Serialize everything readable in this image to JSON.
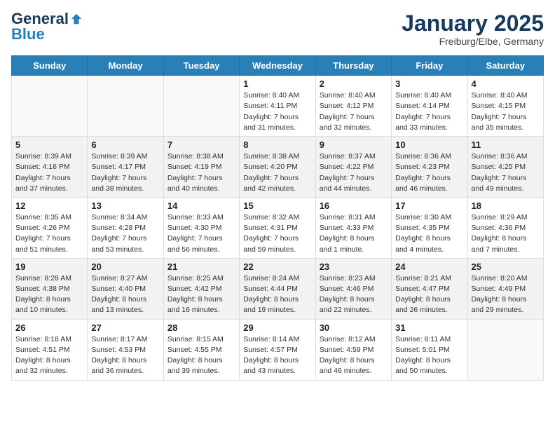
{
  "header": {
    "logo_general": "General",
    "logo_blue": "Blue",
    "month_title": "January 2025",
    "location": "Freiburg/Elbe, Germany"
  },
  "weekdays": [
    "Sunday",
    "Monday",
    "Tuesday",
    "Wednesday",
    "Thursday",
    "Friday",
    "Saturday"
  ],
  "weeks": [
    {
      "shaded": false,
      "days": [
        {
          "num": "",
          "info": ""
        },
        {
          "num": "",
          "info": ""
        },
        {
          "num": "",
          "info": ""
        },
        {
          "num": "1",
          "info": "Sunrise: 8:40 AM\nSunset: 4:11 PM\nDaylight: 7 hours\nand 31 minutes."
        },
        {
          "num": "2",
          "info": "Sunrise: 8:40 AM\nSunset: 4:12 PM\nDaylight: 7 hours\nand 32 minutes."
        },
        {
          "num": "3",
          "info": "Sunrise: 8:40 AM\nSunset: 4:14 PM\nDaylight: 7 hours\nand 33 minutes."
        },
        {
          "num": "4",
          "info": "Sunrise: 8:40 AM\nSunset: 4:15 PM\nDaylight: 7 hours\nand 35 minutes."
        }
      ]
    },
    {
      "shaded": true,
      "days": [
        {
          "num": "5",
          "info": "Sunrise: 8:39 AM\nSunset: 4:16 PM\nDaylight: 7 hours\nand 37 minutes."
        },
        {
          "num": "6",
          "info": "Sunrise: 8:39 AM\nSunset: 4:17 PM\nDaylight: 7 hours\nand 38 minutes."
        },
        {
          "num": "7",
          "info": "Sunrise: 8:38 AM\nSunset: 4:19 PM\nDaylight: 7 hours\nand 40 minutes."
        },
        {
          "num": "8",
          "info": "Sunrise: 8:38 AM\nSunset: 4:20 PM\nDaylight: 7 hours\nand 42 minutes."
        },
        {
          "num": "9",
          "info": "Sunrise: 8:37 AM\nSunset: 4:22 PM\nDaylight: 7 hours\nand 44 minutes."
        },
        {
          "num": "10",
          "info": "Sunrise: 8:36 AM\nSunset: 4:23 PM\nDaylight: 7 hours\nand 46 minutes."
        },
        {
          "num": "11",
          "info": "Sunrise: 8:36 AM\nSunset: 4:25 PM\nDaylight: 7 hours\nand 49 minutes."
        }
      ]
    },
    {
      "shaded": false,
      "days": [
        {
          "num": "12",
          "info": "Sunrise: 8:35 AM\nSunset: 4:26 PM\nDaylight: 7 hours\nand 51 minutes."
        },
        {
          "num": "13",
          "info": "Sunrise: 8:34 AM\nSunset: 4:28 PM\nDaylight: 7 hours\nand 53 minutes."
        },
        {
          "num": "14",
          "info": "Sunrise: 8:33 AM\nSunset: 4:30 PM\nDaylight: 7 hours\nand 56 minutes."
        },
        {
          "num": "15",
          "info": "Sunrise: 8:32 AM\nSunset: 4:31 PM\nDaylight: 7 hours\nand 59 minutes."
        },
        {
          "num": "16",
          "info": "Sunrise: 8:31 AM\nSunset: 4:33 PM\nDaylight: 8 hours\nand 1 minute."
        },
        {
          "num": "17",
          "info": "Sunrise: 8:30 AM\nSunset: 4:35 PM\nDaylight: 8 hours\nand 4 minutes."
        },
        {
          "num": "18",
          "info": "Sunrise: 8:29 AM\nSunset: 4:36 PM\nDaylight: 8 hours\nand 7 minutes."
        }
      ]
    },
    {
      "shaded": true,
      "days": [
        {
          "num": "19",
          "info": "Sunrise: 8:28 AM\nSunset: 4:38 PM\nDaylight: 8 hours\nand 10 minutes."
        },
        {
          "num": "20",
          "info": "Sunrise: 8:27 AM\nSunset: 4:40 PM\nDaylight: 8 hours\nand 13 minutes."
        },
        {
          "num": "21",
          "info": "Sunrise: 8:25 AM\nSunset: 4:42 PM\nDaylight: 8 hours\nand 16 minutes."
        },
        {
          "num": "22",
          "info": "Sunrise: 8:24 AM\nSunset: 4:44 PM\nDaylight: 8 hours\nand 19 minutes."
        },
        {
          "num": "23",
          "info": "Sunrise: 8:23 AM\nSunset: 4:46 PM\nDaylight: 8 hours\nand 22 minutes."
        },
        {
          "num": "24",
          "info": "Sunrise: 8:21 AM\nSunset: 4:47 PM\nDaylight: 8 hours\nand 26 minutes."
        },
        {
          "num": "25",
          "info": "Sunrise: 8:20 AM\nSunset: 4:49 PM\nDaylight: 8 hours\nand 29 minutes."
        }
      ]
    },
    {
      "shaded": false,
      "days": [
        {
          "num": "26",
          "info": "Sunrise: 8:18 AM\nSunset: 4:51 PM\nDaylight: 8 hours\nand 32 minutes."
        },
        {
          "num": "27",
          "info": "Sunrise: 8:17 AM\nSunset: 4:53 PM\nDaylight: 8 hours\nand 36 minutes."
        },
        {
          "num": "28",
          "info": "Sunrise: 8:15 AM\nSunset: 4:55 PM\nDaylight: 8 hours\nand 39 minutes."
        },
        {
          "num": "29",
          "info": "Sunrise: 8:14 AM\nSunset: 4:57 PM\nDaylight: 8 hours\nand 43 minutes."
        },
        {
          "num": "30",
          "info": "Sunrise: 8:12 AM\nSunset: 4:59 PM\nDaylight: 8 hours\nand 46 minutes."
        },
        {
          "num": "31",
          "info": "Sunrise: 8:11 AM\nSunset: 5:01 PM\nDaylight: 8 hours\nand 50 minutes."
        },
        {
          "num": "",
          "info": ""
        }
      ]
    }
  ]
}
